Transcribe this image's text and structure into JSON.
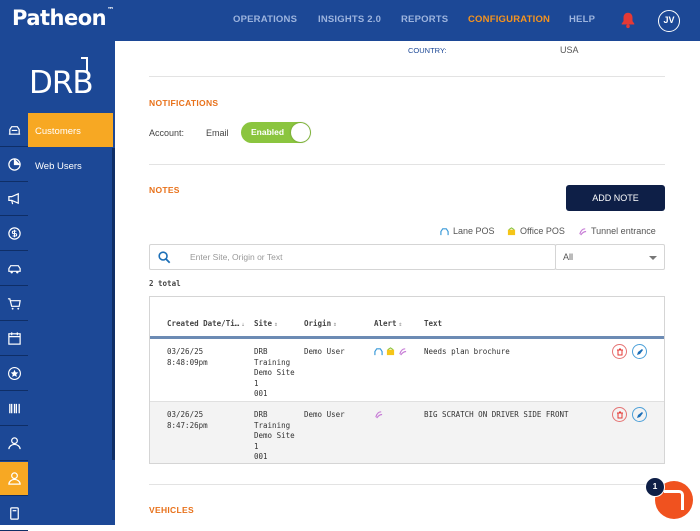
{
  "brand": {
    "logo_text": "Patheon",
    "trademark": "™",
    "side_logo": "DRB"
  },
  "nav": [
    {
      "label": "OPERATIONS"
    },
    {
      "label": "INSIGHTS 2.0"
    },
    {
      "label": "REPORTS"
    },
    {
      "label": "CONFIGURATION",
      "active": true
    },
    {
      "label": "HELP"
    }
  ],
  "user": {
    "initials": "JV"
  },
  "colors": {
    "nav_bg": "#1c4896",
    "active": "#f7a823",
    "accent_orange": "#e8711a",
    "toggle_on": "#8bc53f",
    "button_dark": "#0e1f47"
  },
  "rail_icons": [
    "car-wash-icon",
    "pie-chart-icon",
    "megaphone-icon",
    "dollar-icon",
    "car-icon",
    "cart-icon",
    "calendar-icon",
    "star-icon",
    "barcode-icon",
    "employee-icon",
    "customer-icon",
    "device-icon"
  ],
  "subnav": {
    "items": [
      {
        "label": "Customers",
        "active": true
      },
      {
        "label": "Web Users"
      }
    ]
  },
  "customer": {
    "country_label": "COUNTRY:",
    "country_value": "USA"
  },
  "notifications": {
    "title": "NOTIFICATIONS",
    "account_label": "Account:",
    "email_label": "Email",
    "toggle_label": "Enabled",
    "toggle_on": true
  },
  "notes": {
    "title": "NOTES",
    "add_button": "ADD NOTE",
    "legend": [
      {
        "label": "Lane POS",
        "icon": "lane-pos-icon"
      },
      {
        "label": "Office POS",
        "icon": "office-pos-icon"
      },
      {
        "label": "Tunnel entrance",
        "icon": "tunnel-entrance-icon"
      }
    ],
    "search_placeholder": "Enter Site, Origin or Text",
    "filter_value": "All",
    "total": "2 total",
    "columns": [
      "Created Date/Ti…",
      "Site",
      "Origin",
      "Alert",
      "Text"
    ],
    "rows": [
      {
        "date": "03/26/25\n8:48:09pm",
        "site": "DRB\nTraining\nDemo Site\n1\n001",
        "origin": "Demo User",
        "alerts": [
          "lane-pos-icon",
          "office-pos-icon",
          "tunnel-entrance-icon"
        ],
        "text": "Needs plan brochure"
      },
      {
        "date": "03/26/25\n8:47:26pm",
        "site": "DRB\nTraining\nDemo Site\n1\n001",
        "origin": "Demo User",
        "alerts": [
          "tunnel-entrance-icon"
        ],
        "text": "BIG SCRATCH ON DRIVER SIDE FRONT"
      }
    ]
  },
  "vehicles": {
    "title": "VEHICLES"
  },
  "chat": {
    "badge": "1"
  }
}
